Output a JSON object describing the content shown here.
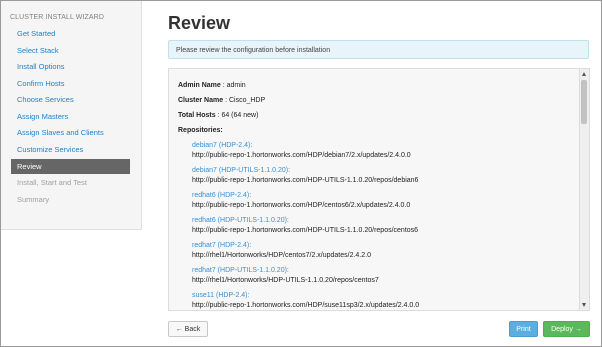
{
  "sidebar": {
    "title": "CLUSTER INSTALL WIZARD",
    "items": [
      {
        "label": "Get Started",
        "state": "done"
      },
      {
        "label": "Select Stack",
        "state": "done"
      },
      {
        "label": "Install Options",
        "state": "done"
      },
      {
        "label": "Confirm Hosts",
        "state": "done"
      },
      {
        "label": "Choose Services",
        "state": "done"
      },
      {
        "label": "Assign Masters",
        "state": "done"
      },
      {
        "label": "Assign Slaves and Clients",
        "state": "done"
      },
      {
        "label": "Customize Services",
        "state": "done"
      },
      {
        "label": "Review",
        "state": "active"
      },
      {
        "label": "Install, Start and Test",
        "state": "disabled"
      },
      {
        "label": "Summary",
        "state": "disabled"
      }
    ]
  },
  "main": {
    "title": "Review",
    "alert": "Please review the configuration before installation",
    "admin_label": "Admin Name",
    "admin_value": " : admin",
    "cluster_label": "Cluster Name",
    "cluster_value": " : Cisco_HDP",
    "hosts_label": "Total Hosts",
    "hosts_value": " :  64 (64 new)",
    "repos_label": "Repositories",
    "repositories": [
      {
        "name": "debian7 (HDP-2.4):",
        "url": "http://public-repo-1.hortonworks.com/HDP/debian7/2.x/updates/2.4.0.0"
      },
      {
        "name": "debian7 (HDP-UTILS-1.1.0.20):",
        "url": "http://public-repo-1.hortonworks.com/HDP-UTILS-1.1.0.20/repos/debian6"
      },
      {
        "name": "redhat6 (HDP-2.4):",
        "url": "http://public-repo-1.hortonworks.com/HDP/centos6/2.x/updates/2.4.0.0"
      },
      {
        "name": "redhat6 (HDP-UTILS-1.1.0.20):",
        "url": "http://public-repo-1.hortonworks.com/HDP-UTILS-1.1.0.20/repos/centos6"
      },
      {
        "name": "redhat7 (HDP-2.4):",
        "url": "http://rhel1/Hortonworks/HDP/centos7/2.x/updates/2.4.2.0"
      },
      {
        "name": "redhat7 (HDP-UTILS-1.1.0.20):",
        "url": "http://rhel1/Hortonworks/HDP-UTILS-1.1.0.20/repos/centos7"
      },
      {
        "name": "suse11 (HDP-2.4):",
        "url": "http://public-repo-1.hortonworks.com/HDP/suse11sp3/2.x/updates/2.4.0.0"
      }
    ]
  },
  "buttons": {
    "back": "← Back",
    "print": "Print",
    "deploy": "Deploy →"
  }
}
